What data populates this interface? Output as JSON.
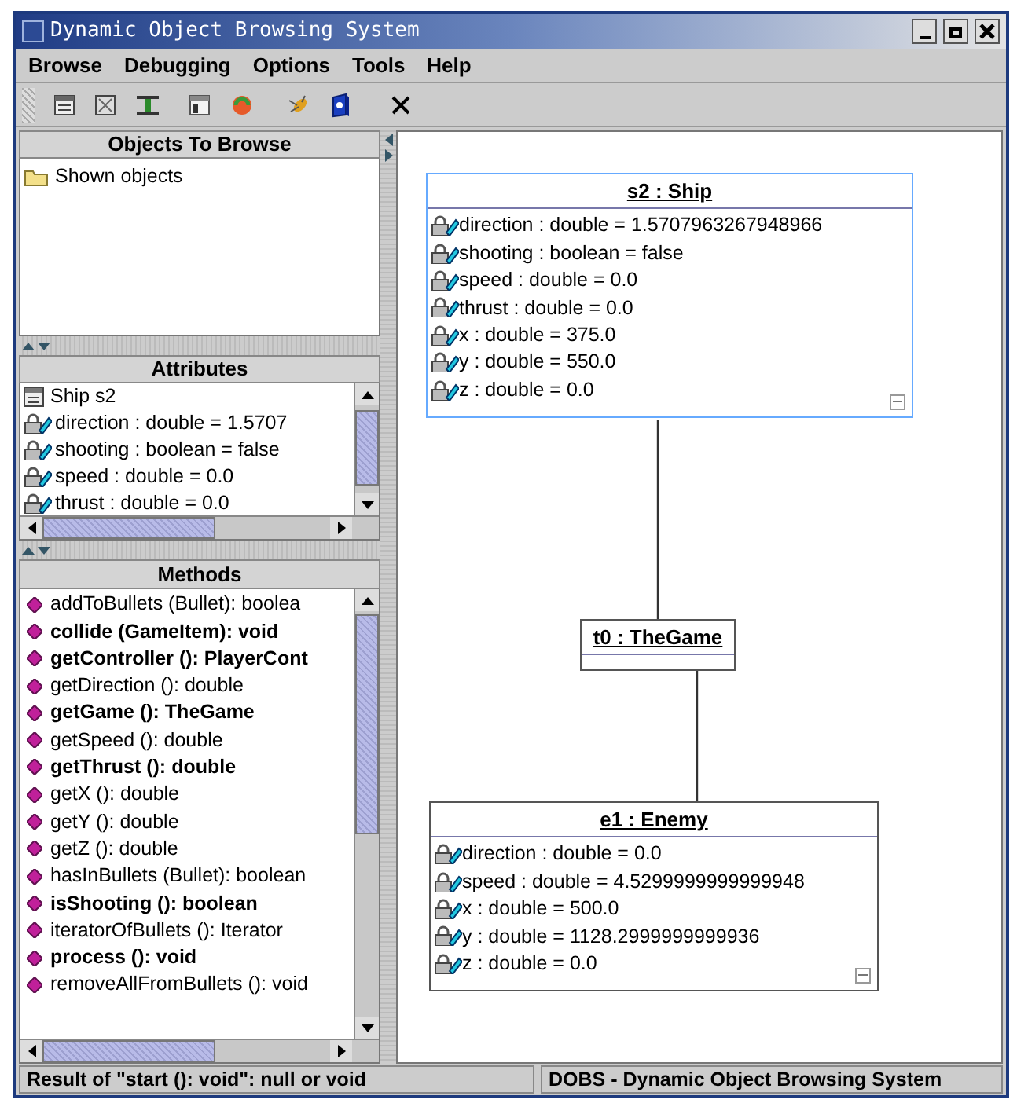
{
  "window": {
    "title": "Dynamic Object Browsing System"
  },
  "menu": [
    {
      "label": "Browse"
    },
    {
      "label": "Debugging"
    },
    {
      "label": "Options"
    },
    {
      "label": "Tools"
    },
    {
      "label": "Help"
    }
  ],
  "objects_panel": {
    "title": "Objects To Browse",
    "items": [
      {
        "label": "Shown objects"
      }
    ]
  },
  "attributes_panel": {
    "title": "Attributes",
    "object": "Ship s2",
    "items": [
      {
        "label": "direction : double = 1.5707"
      },
      {
        "label": "shooting : boolean = false"
      },
      {
        "label": "speed : double = 0.0"
      },
      {
        "label": "thrust : double = 0.0"
      }
    ]
  },
  "methods_panel": {
    "title": "Methods",
    "items": [
      {
        "label": "addToBullets (Bullet): boolea",
        "bold": false
      },
      {
        "label": "collide (GameItem): void",
        "bold": true
      },
      {
        "label": "getController (): PlayerCont",
        "bold": true
      },
      {
        "label": "getDirection (): double",
        "bold": false
      },
      {
        "label": "getGame (): TheGame",
        "bold": true
      },
      {
        "label": "getSpeed (): double",
        "bold": false
      },
      {
        "label": "getThrust (): double",
        "bold": true
      },
      {
        "label": "getX (): double",
        "bold": false
      },
      {
        "label": "getY (): double",
        "bold": false
      },
      {
        "label": "getZ (): double",
        "bold": false
      },
      {
        "label": "hasInBullets (Bullet): boolean",
        "bold": false
      },
      {
        "label": "isShooting (): boolean",
        "bold": true
      },
      {
        "label": "iteratorOfBullets (): Iterator",
        "bold": false
      },
      {
        "label": "process (): void",
        "bold": true
      },
      {
        "label": "removeAllFromBullets (): void",
        "bold": false
      }
    ]
  },
  "diagram": {
    "nodes": [
      {
        "title": "s2 : Ship",
        "selected": true,
        "attributes": [
          "direction : double = 1.5707963267948966",
          "shooting : boolean = false",
          "speed : double = 0.0",
          "thrust : double = 0.0",
          "x : double = 375.0",
          "y : double = 550.0",
          "z : double = 0.0"
        ]
      },
      {
        "title": "t0 : TheGame",
        "selected": false
      },
      {
        "title": "e1 : Enemy",
        "selected": false,
        "attributes": [
          "direction : double = 0.0",
          "speed : double = 4.5299999999999948",
          "x : double = 500.0",
          "y : double = 1128.2999999999936",
          "z : double = 0.0"
        ]
      }
    ]
  },
  "status_bar": {
    "message": "Result of \"start (): void\": null or void",
    "app": "DOBS - Dynamic Object Browsing System"
  }
}
